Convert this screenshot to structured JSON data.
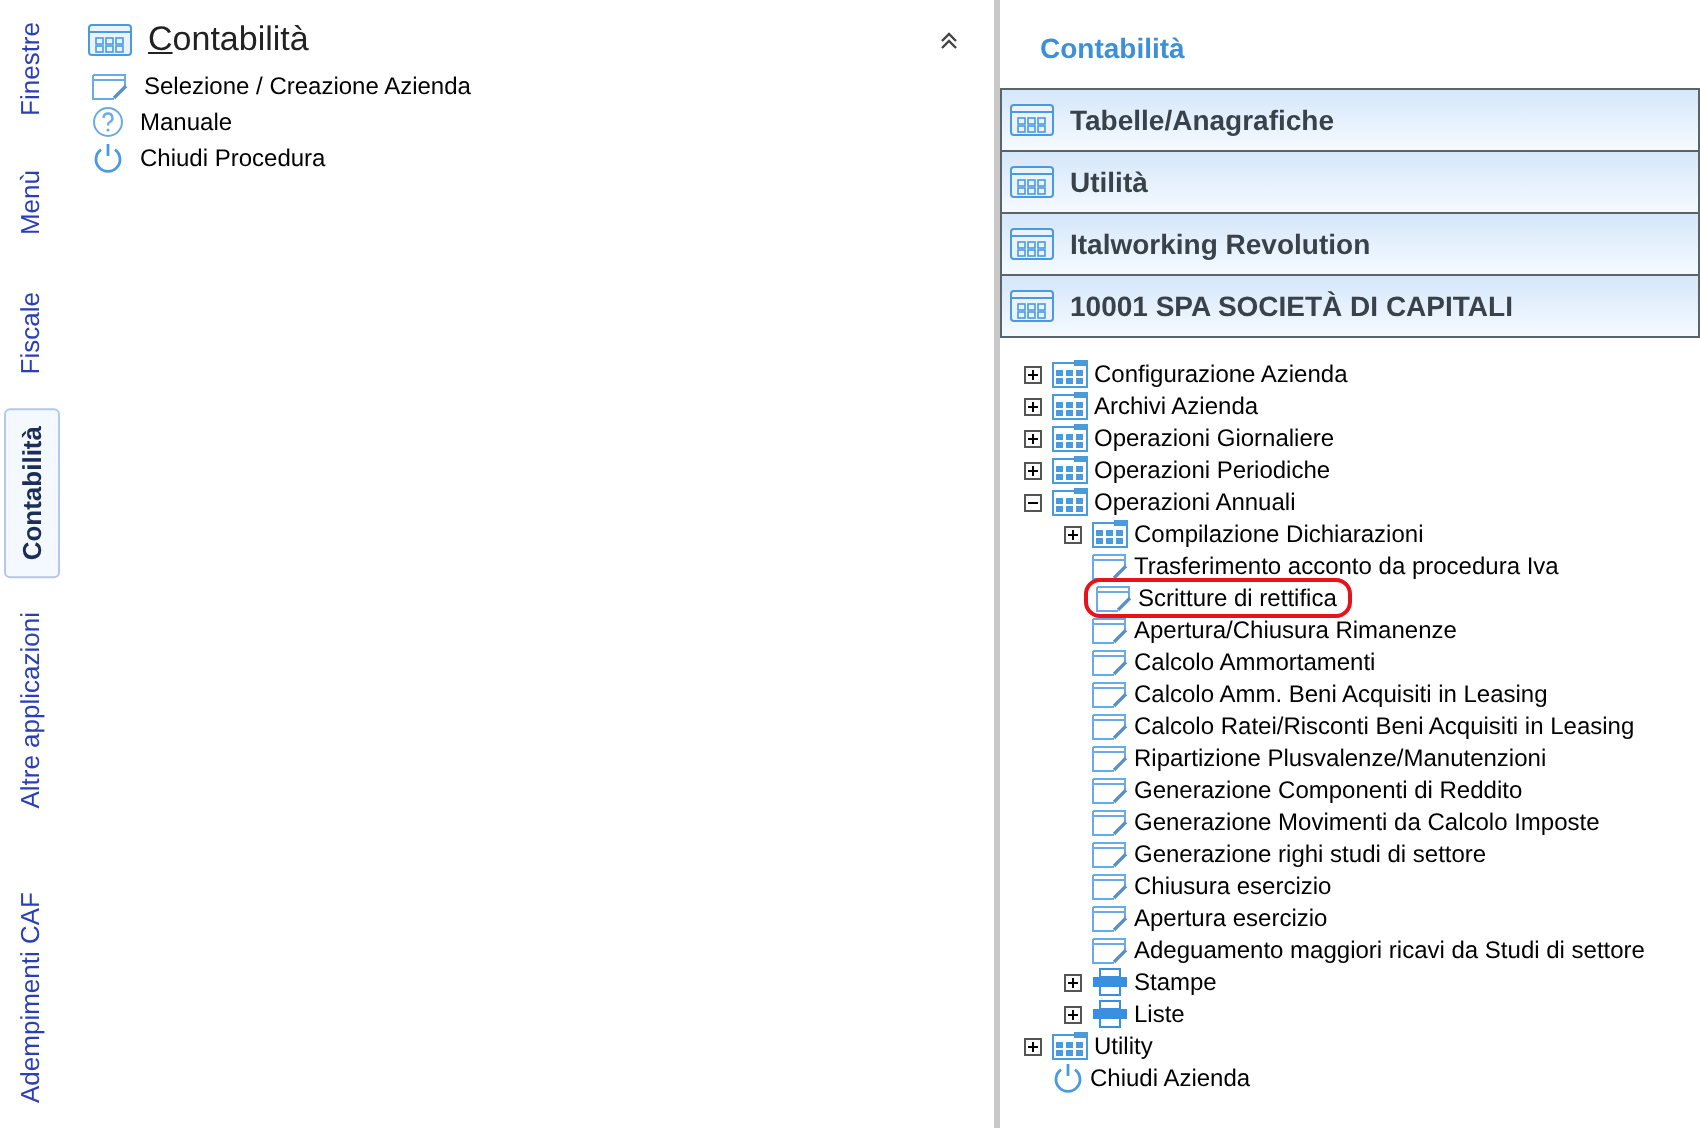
{
  "side_tabs": [
    {
      "label": "Finestre",
      "selected": false
    },
    {
      "label": "Menù",
      "selected": false
    },
    {
      "label": "Fiscale",
      "selected": false
    },
    {
      "label": "Contabilità",
      "selected": true
    },
    {
      "label": "Altre applicazioni",
      "selected": false
    },
    {
      "label": "Adempimenti CAF",
      "selected": false
    }
  ],
  "left_panel": {
    "title": "Contabilità",
    "expanded": true,
    "items": [
      {
        "label": "Selezione / Creazione Azienda",
        "kind": "form"
      },
      {
        "label": "Manuale",
        "kind": "help"
      },
      {
        "label": "Chiudi Procedura",
        "kind": "power"
      }
    ]
  },
  "right_panel": {
    "title": "Contabilità",
    "sections": [
      {
        "label": "Tabelle/Anagrafiche"
      },
      {
        "label": "Utilità"
      },
      {
        "label": "Italworking Revolution"
      },
      {
        "label": "10001 SPA SOCIETÀ DI CAPITALI"
      }
    ],
    "tree": [
      {
        "label": "Configurazione Azienda",
        "kind": "folder",
        "expanded": false,
        "circled": false
      },
      {
        "label": "Archivi Azienda",
        "kind": "folder",
        "expanded": false,
        "circled": false
      },
      {
        "label": "Operazioni Giornaliere",
        "kind": "folder",
        "expanded": false,
        "circled": false
      },
      {
        "label": "Operazioni Periodiche",
        "kind": "folder",
        "expanded": false,
        "circled": false
      },
      {
        "label": "Operazioni Annuali",
        "kind": "folder",
        "expanded": true,
        "circled": false,
        "children": [
          {
            "label": "Compilazione Dichiarazioni",
            "kind": "folder",
            "expanded": false,
            "circled": false
          },
          {
            "label": "Trasferimento acconto da procedura Iva",
            "kind": "form",
            "circled": false
          },
          {
            "label": "Scritture di rettifica",
            "kind": "form",
            "circled": true
          },
          {
            "label": "Apertura/Chiusura Rimanenze",
            "kind": "form",
            "circled": false
          },
          {
            "label": "Calcolo Ammortamenti",
            "kind": "form",
            "circled": false
          },
          {
            "label": "Calcolo Amm. Beni Acquisiti in Leasing",
            "kind": "form",
            "circled": false
          },
          {
            "label": "Calcolo Ratei/Risconti Beni Acquisiti in Leasing",
            "kind": "form",
            "circled": false
          },
          {
            "label": "Ripartizione Plusvalenze/Manutenzioni",
            "kind": "form",
            "circled": false
          },
          {
            "label": "Generazione Componenti di Reddito",
            "kind": "form",
            "circled": false
          },
          {
            "label": "Generazione Movimenti da Calcolo Imposte",
            "kind": "form",
            "circled": false
          },
          {
            "label": "Generazione righi studi di settore",
            "kind": "form",
            "circled": false
          },
          {
            "label": "Chiusura esercizio",
            "kind": "form",
            "circled": false
          },
          {
            "label": "Apertura esercizio",
            "kind": "form",
            "circled": false
          },
          {
            "label": "Adeguamento maggiori ricavi da Studi di settore",
            "kind": "form",
            "circled": false
          },
          {
            "label": "Stampe",
            "kind": "print",
            "expanded": false,
            "circled": false
          },
          {
            "label": "Liste",
            "kind": "print",
            "expanded": false,
            "circled": false
          }
        ]
      },
      {
        "label": "Utility",
        "kind": "folder",
        "expanded": false,
        "circled": false
      },
      {
        "label": "Chiudi Azienda",
        "kind": "power",
        "circled": false
      }
    ]
  }
}
